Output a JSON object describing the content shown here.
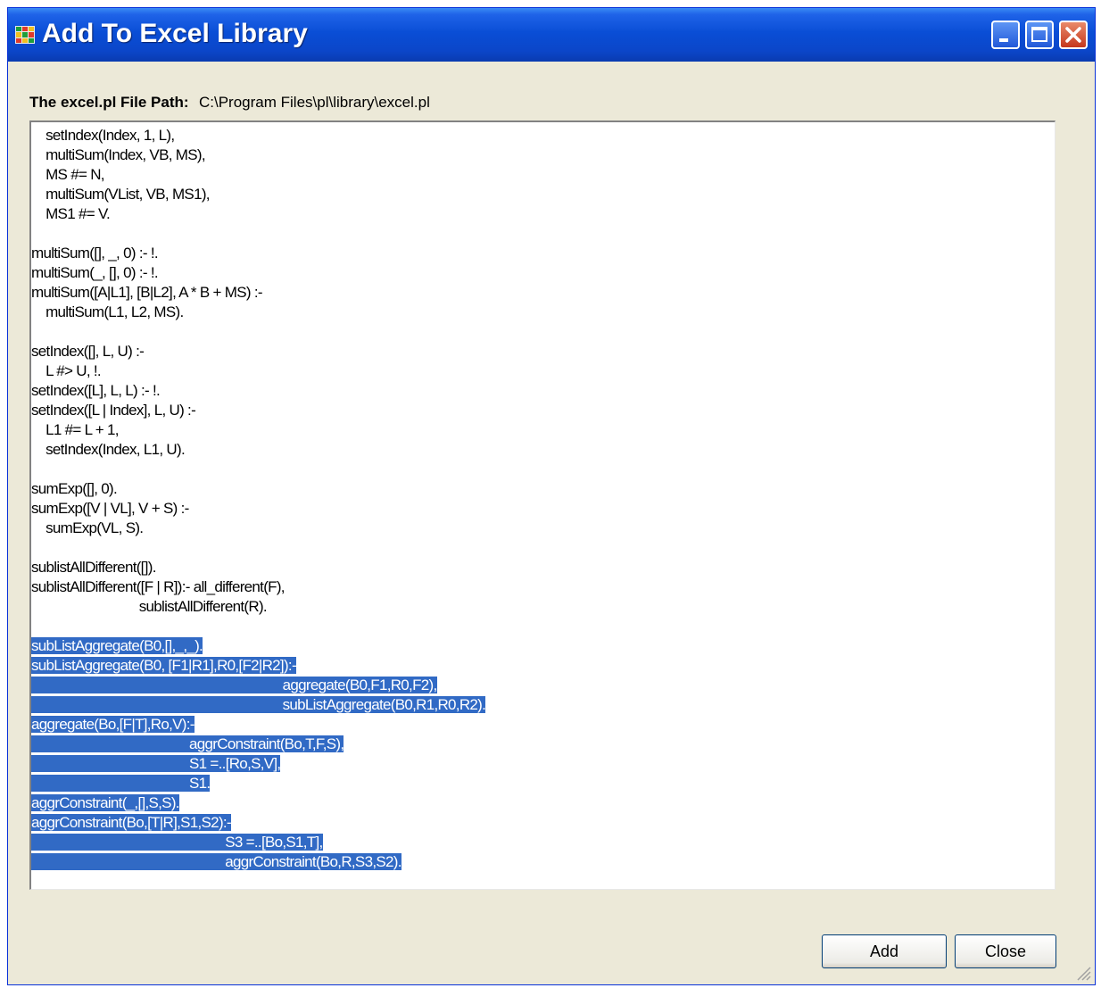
{
  "window": {
    "title": "Add To Excel Library"
  },
  "file_path": {
    "label": "The excel.pl File Path:",
    "value": "C:\\Program Files\\pl\\library\\excel.pl"
  },
  "editor": {
    "lines": [
      {
        "text": "    setIndex(Index, 1, L),",
        "selected": false
      },
      {
        "text": "    multiSum(Index, VB, MS),",
        "selected": false
      },
      {
        "text": "    MS #= N,",
        "selected": false
      },
      {
        "text": "    multiSum(VList, VB, MS1),",
        "selected": false
      },
      {
        "text": "    MS1 #= V.",
        "selected": false
      },
      {
        "text": "",
        "selected": false
      },
      {
        "text": "multiSum([], _, 0) :- !.",
        "selected": false
      },
      {
        "text": "multiSum(_, [], 0) :- !.",
        "selected": false
      },
      {
        "text": "multiSum([A|L1], [B|L2], A * B + MS) :-",
        "selected": false
      },
      {
        "text": "    multiSum(L1, L2, MS).",
        "selected": false
      },
      {
        "text": "",
        "selected": false
      },
      {
        "text": "setIndex([], L, U) :-",
        "selected": false
      },
      {
        "text": "    L #> U, !.",
        "selected": false
      },
      {
        "text": "setIndex([L], L, L) :- !.",
        "selected": false
      },
      {
        "text": "setIndex([L | Index], L, U) :-",
        "selected": false
      },
      {
        "text": "    L1 #= L + 1,",
        "selected": false
      },
      {
        "text": "    setIndex(Index, L1, U).",
        "selected": false
      },
      {
        "text": "",
        "selected": false
      },
      {
        "text": "sumExp([], 0).",
        "selected": false
      },
      {
        "text": "sumExp([V | VL], V + S) :-",
        "selected": false
      },
      {
        "text": "    sumExp(VL, S).",
        "selected": false
      },
      {
        "text": "",
        "selected": false
      },
      {
        "text": "sublistAllDifferent([]).",
        "selected": false
      },
      {
        "text": "sublistAllDifferent([F | R]):- all_different(F),",
        "selected": false
      },
      {
        "text": "                              sublistAllDifferent(R).",
        "selected": false
      },
      {
        "text": "",
        "selected": false
      },
      {
        "text": "subListAggregate(B0,[],_,_).",
        "selected": true
      },
      {
        "text": "subListAggregate(B0, [F1|R1],R0,[F2|R2]):-",
        "selected": true
      },
      {
        "text": "                                                                      aggregate(B0,F1,R0,F2),",
        "selected": true
      },
      {
        "text": "                                                                      subListAggregate(B0,R1,R0,R2).",
        "selected": true
      },
      {
        "text": "aggregate(Bo,[F|T],Ro,V):-",
        "selected": true
      },
      {
        "text": "                                            aggrConstraint(Bo,T,F,S),",
        "selected": true
      },
      {
        "text": "                                            S1 =..[Ro,S,V],",
        "selected": true
      },
      {
        "text": "                                            S1.",
        "selected": true
      },
      {
        "text": "aggrConstraint(_,[],S,S).",
        "selected": true
      },
      {
        "text": "aggrConstraint(Bo,[T|R],S1,S2):-",
        "selected": true
      },
      {
        "text": "                                                      S3 =..[Bo,S1,T],",
        "selected": true
      },
      {
        "text": "                                                      aggrConstraint(Bo,R,S3,S2).",
        "selected": true
      }
    ]
  },
  "buttons": {
    "add": "Add",
    "close": "Close"
  }
}
